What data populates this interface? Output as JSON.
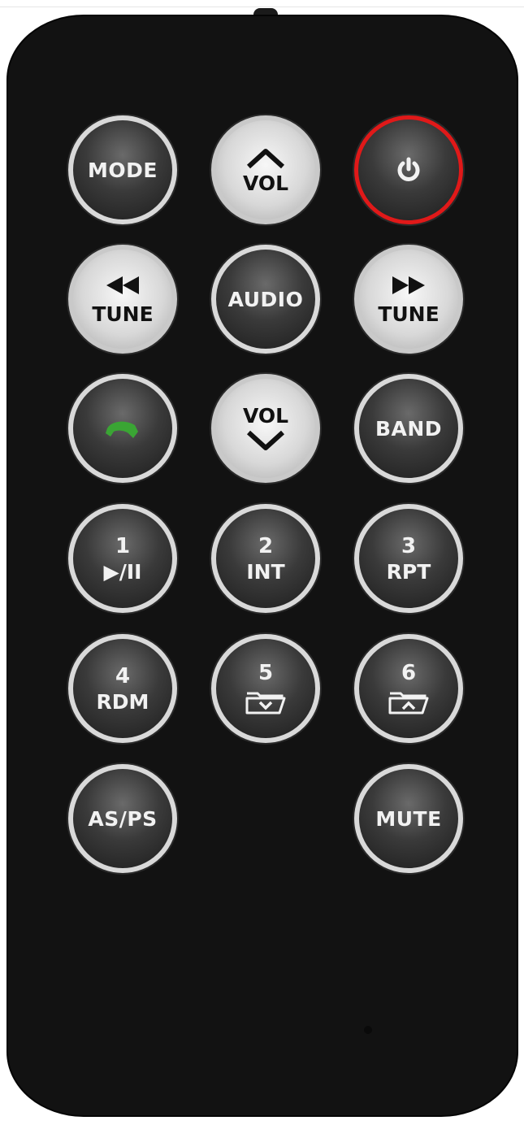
{
  "remote": {
    "buttons": {
      "mode": {
        "label": "MODE"
      },
      "vol_up": {
        "label": "VOL"
      },
      "tune_back": {
        "label": "TUNE"
      },
      "audio": {
        "label": "AUDIO"
      },
      "tune_forward": {
        "label": "TUNE"
      },
      "vol_down": {
        "label": "VOL"
      },
      "band": {
        "label": "BAND"
      },
      "play_pause": {
        "number": "1",
        "label": "▶/II"
      },
      "int": {
        "number": "2",
        "label": "INT"
      },
      "rpt": {
        "number": "3",
        "label": "RPT"
      },
      "rdm": {
        "number": "4",
        "label": "RDM"
      },
      "folder_down": {
        "number": "5"
      },
      "folder_up": {
        "number": "6"
      },
      "as_ps": {
        "label": "AS/PS"
      },
      "mute": {
        "label": "MUTE"
      }
    },
    "colors": {
      "body": "#121212",
      "power_ring": "#e01919",
      "call_icon": "#3aa534"
    },
    "icons": [
      "power-icon",
      "chevron-up-icon",
      "rewind-icon",
      "fast-forward-icon",
      "phone-icon",
      "chevron-down-icon",
      "folder-down-icon",
      "folder-up-icon"
    ]
  }
}
